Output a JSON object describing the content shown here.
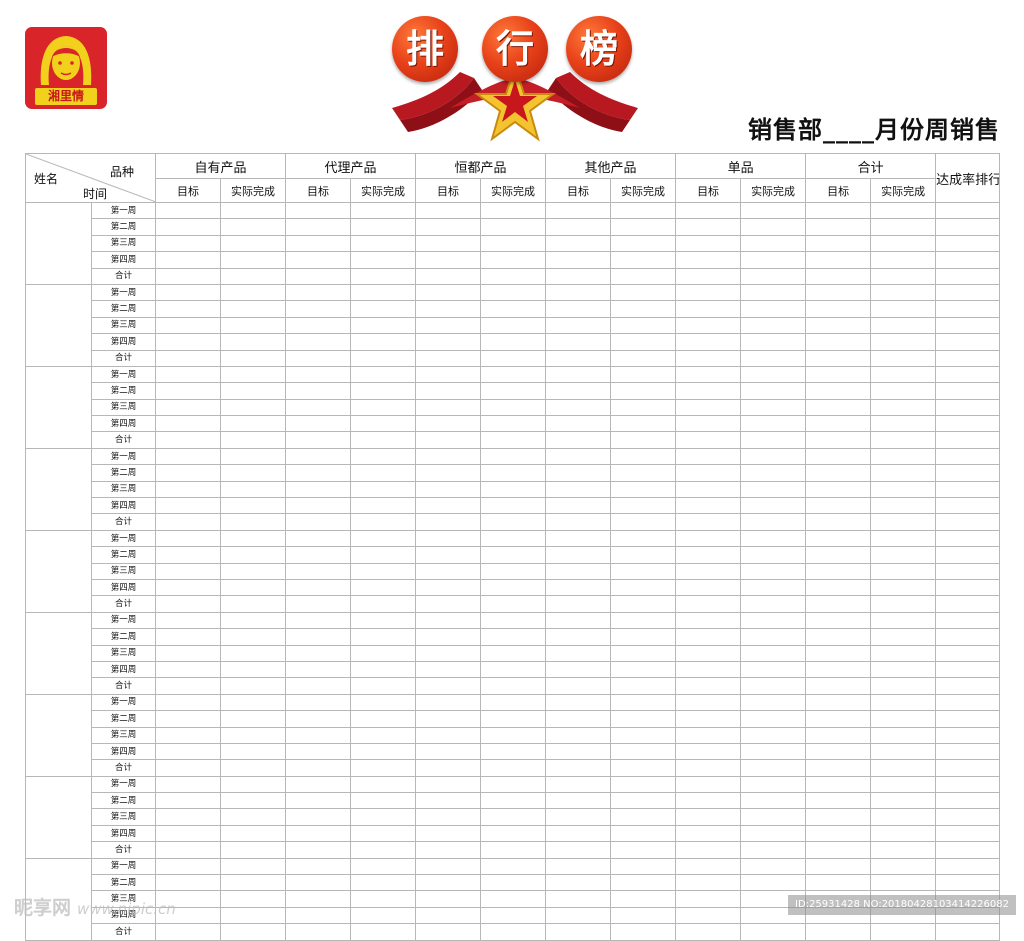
{
  "logo": {
    "text": "湘里情"
  },
  "banner": {
    "chars": [
      "排",
      "行",
      "榜"
    ]
  },
  "subtitle": "销售部____月份周销售",
  "table": {
    "corner": {
      "name_label": "姓名",
      "category_label": "品种",
      "time_label": "时间"
    },
    "categories": [
      "自有产品",
      "代理产品",
      "恒都产品",
      "其他产品",
      "单品",
      "合计"
    ],
    "sub_headers": [
      "目标",
      "实际完成"
    ],
    "rank_header": "达成率排行",
    "week_labels": [
      "第一周",
      "第二周",
      "第三周",
      "第四周",
      "合计"
    ],
    "person_groups": 9
  },
  "watermark": {
    "left_text": "昵享网",
    "left_url": "www.nipic.cn",
    "right_text": "ID:25931428 NO:20180428103414226082"
  },
  "colors": {
    "logo_bg": "#d9252a",
    "logo_gold": "#f2d11c",
    "badge": "#e8421a",
    "ribbon": "#b81820",
    "star": "#f4c430",
    "grid": "#b7b7b7"
  }
}
